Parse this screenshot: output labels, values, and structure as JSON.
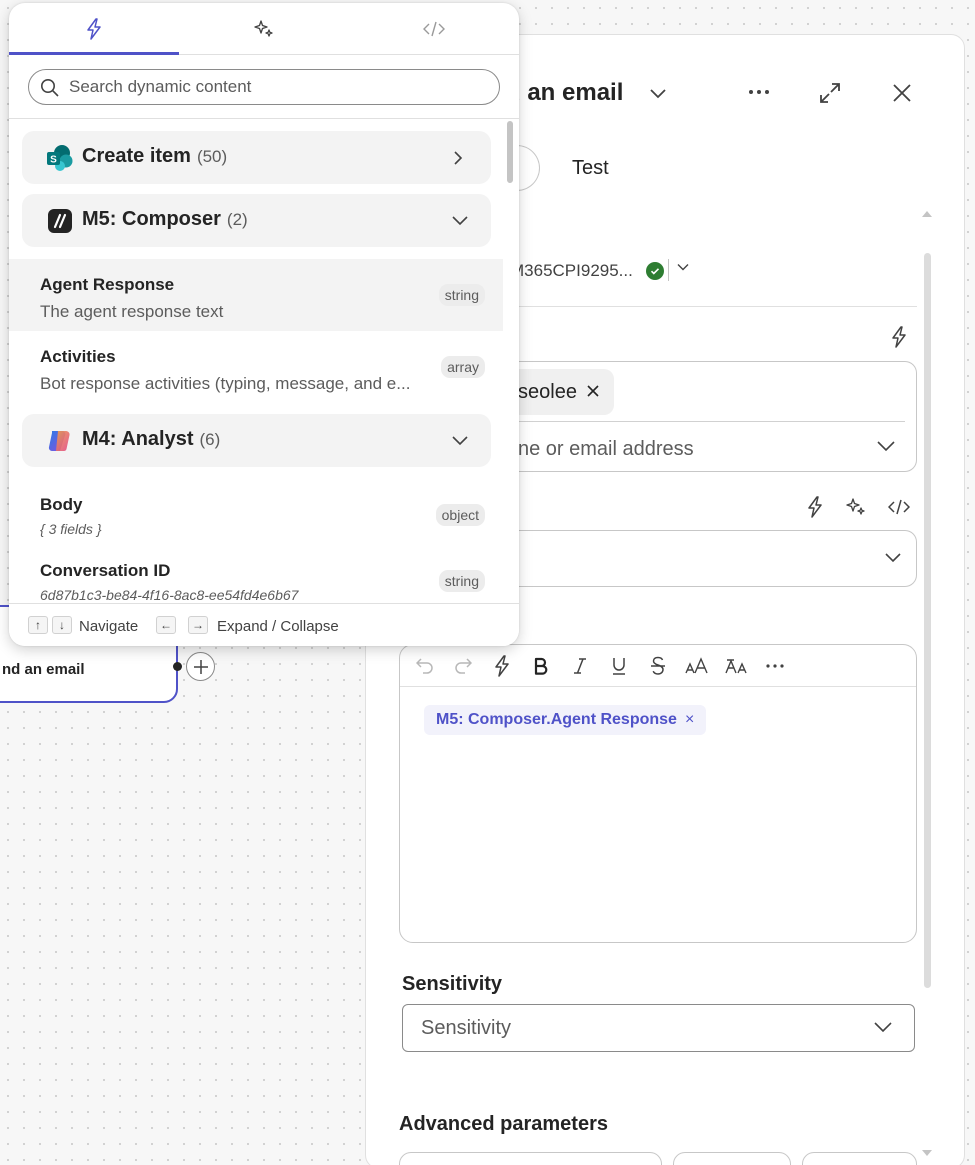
{
  "canvas": {
    "node_label": "nd an email"
  },
  "panel": {
    "title": "d an email",
    "tabs": {
      "test": "Test"
    },
    "connection": {
      "name": "M365CPI9295..."
    },
    "to": {
      "chip": "seolee",
      "placeholder": "ne or email address"
    },
    "body": {
      "token": "M5: Composer.Agent Response",
      "token_remove": "×"
    },
    "sensitivity": {
      "label": "Sensitivity",
      "placeholder": "Sensitivity"
    },
    "advanced": {
      "label": "Advanced parameters"
    }
  },
  "flyout": {
    "search": {
      "placeholder": "Search dynamic content"
    },
    "groups": [
      {
        "name": "Create item",
        "count": "(50)"
      },
      {
        "name": "M5: Composer",
        "count": "(2)",
        "items": [
          {
            "title": "Agent Response",
            "desc": "The agent response text",
            "type": "string"
          },
          {
            "title": "Activities",
            "desc": "Bot response activities (typing, message, and e...",
            "type": "array"
          }
        ]
      },
      {
        "name": "M4: Analyst",
        "count": "(6)",
        "items": [
          {
            "title": "Body",
            "desc": "{ 3 fields }",
            "type": "object"
          },
          {
            "title": "Conversation ID",
            "desc": "6d87b1c3-be84-4f16-8ac8-ee54fd4e6b67",
            "type": "string"
          }
        ]
      }
    ],
    "footer": {
      "up_key": "↑",
      "down_key": "↓",
      "navigate": "Navigate",
      "left_key": "←",
      "right_key": "→",
      "expand_collapse": "Expand / Collapse"
    }
  },
  "colors": {
    "accent": "#4f52c8",
    "success": "#2e7d32",
    "highlight": "#f3f3f3"
  }
}
